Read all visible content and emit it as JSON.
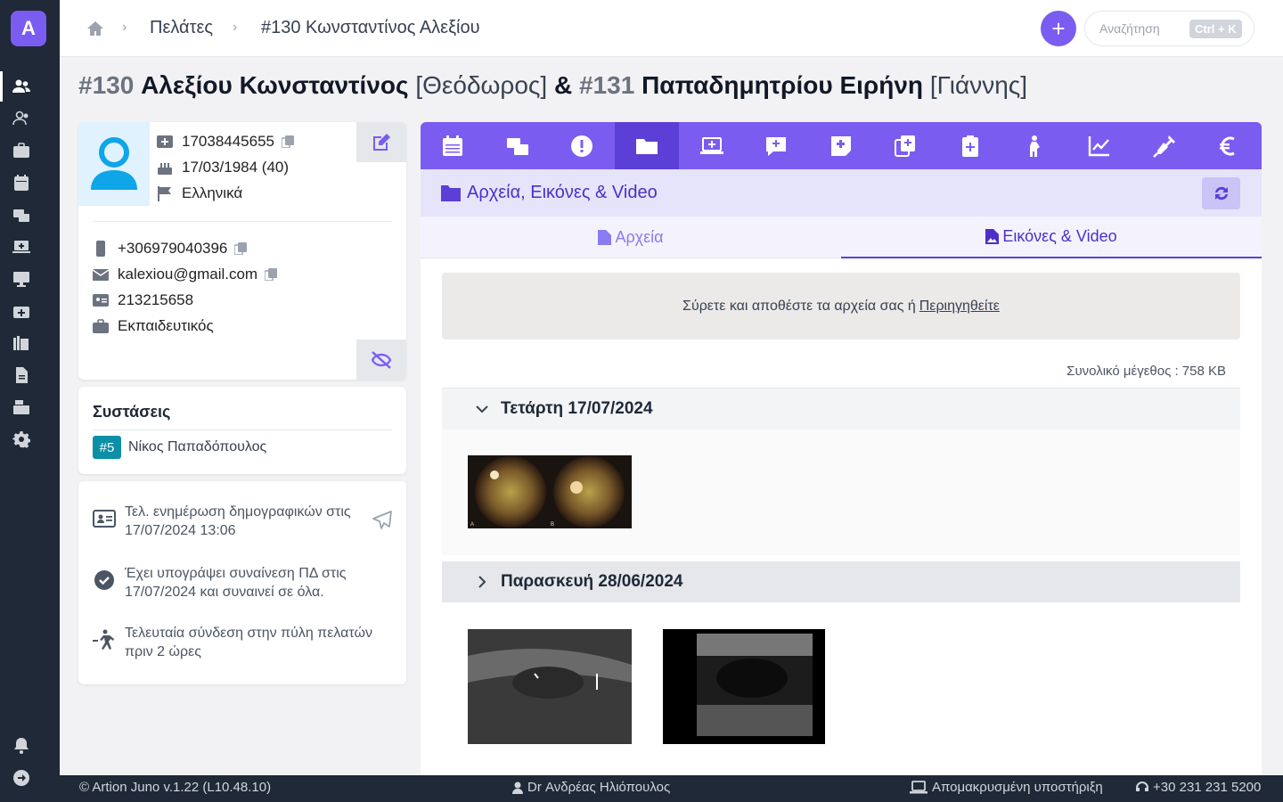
{
  "app": {
    "logo_letter": "A"
  },
  "breadcrumb": {
    "level1": "Πελάτες",
    "level2": "#130 Κωνσταντίνος Αλεξίου"
  },
  "search": {
    "placeholder": "Αναζήτηση",
    "shortcut": "Ctrl + K"
  },
  "title": {
    "p1_num": "#130",
    "p1_name": "Αλεξίου Κωνσταντίνος",
    "p1_father": "[Θεόδωρος]",
    "amp": "&",
    "p2_num": "#131",
    "p2_name": "Παπαδημητρίου Ειρήνη",
    "p2_father": "[Γιάννης]"
  },
  "patient": {
    "amka": "17038445655",
    "birth": "17/03/1984 (40)",
    "language": "Ελληνικά",
    "phone": "+306979040396",
    "email": "kalexiou@gmail.com",
    "id_number": "213215658",
    "profession": "Εκπαιδευτικός"
  },
  "referrals": {
    "heading": "Συστάσεις",
    "badge": "#5",
    "name": "Νίκος Παπαδόπουλος"
  },
  "meta": {
    "demographics": "Τελ. ενημέρωση δημογραφικών στις 17/07/2024 13:06",
    "consent": "Έχει υπογράψει συναίνεση ΠΔ στις 17/07/2024 και συναινεί σε όλα.",
    "portal": "Τελευταία σύνδεση στην πύλη πελατών πριν 2 ώρες"
  },
  "section": {
    "title": "Αρχεία, Εικόνες & Video"
  },
  "tabs": {
    "files": "Αρχεία",
    "images": "Εικόνες & Video"
  },
  "dropzone": {
    "text": "Σύρετε και αποθέστε τα αρχεία σας ή",
    "browse": "Περιηγηθείτε"
  },
  "total_size": "Συνολικό μέγεθος : 758 KB",
  "groups": [
    {
      "date": "Τετάρτη 17/07/2024",
      "expanded": true,
      "images": [
        "fundus-photo"
      ]
    },
    {
      "date": "Παρασκευή 28/06/2024",
      "expanded": false,
      "images": [
        "ultrasound-1",
        "ultrasound-2"
      ]
    }
  ],
  "footer": {
    "version": "© Artion Juno v.1.22 (L10.48.10)",
    "user": "Dr Ανδρέας Ηλιόπουλος",
    "remote": "Απομακρυσμένη υποστήριξη",
    "phone": "+30 231 231 5200"
  },
  "colors": {
    "accent": "#7b5cf0",
    "sidebar": "#1f2937",
    "badge": "#0e8fa8"
  }
}
